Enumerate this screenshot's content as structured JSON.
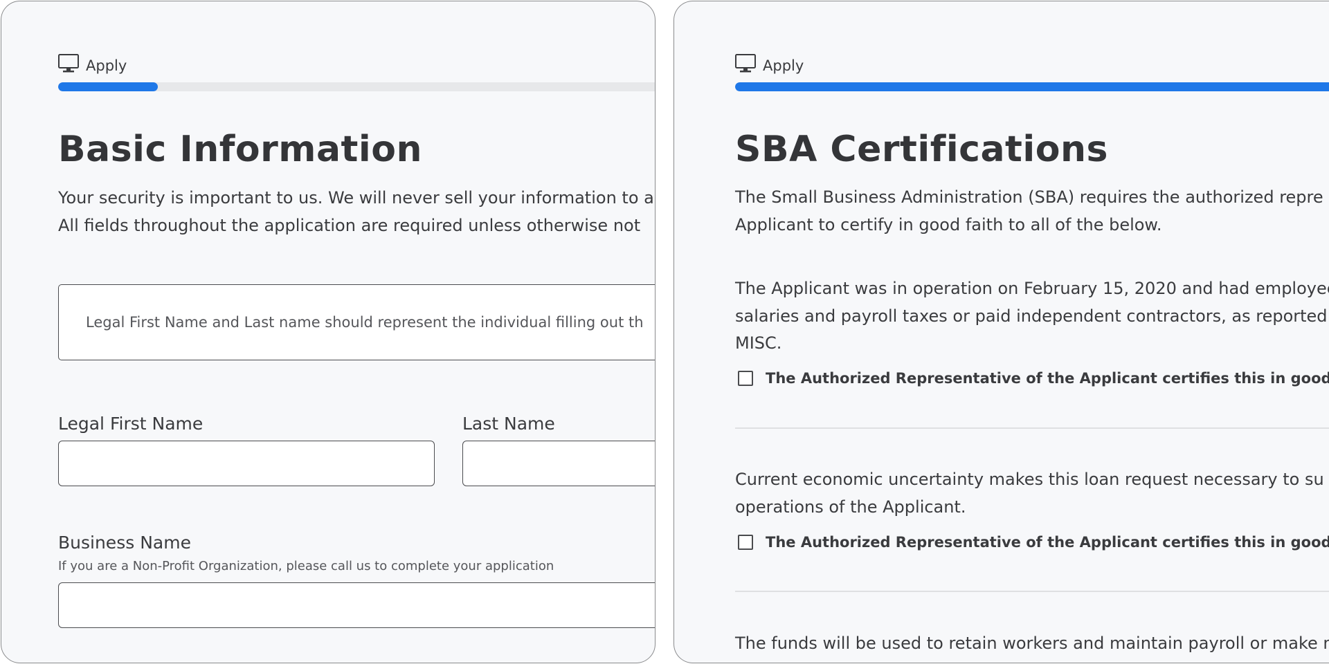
{
  "basic_info": {
    "header": {
      "label": "Apply",
      "icon": "monitor-icon",
      "progress": 0.12
    },
    "title": "Basic Information",
    "intro": [
      "Your security is important to us. We will never sell your information to a",
      "All fields throughout the application are required unless otherwise not"
    ],
    "note": "Legal First Name and Last name should represent the individual filling out th",
    "fields": {
      "first_name": {
        "label": "Legal First Name",
        "value": ""
      },
      "last_name": {
        "label": "Last Name",
        "value": ""
      },
      "business_name": {
        "label": "Business Name",
        "hint": "If you are a Non-Profit Organization, please call us to complete your application",
        "value": ""
      }
    }
  },
  "sba": {
    "header": {
      "label": "Apply",
      "icon": "monitor-icon",
      "progress": 0.85
    },
    "title": "SBA Certifications",
    "intro": [
      "The Small Business Administration (SBA) requires the authorized repre",
      "Applicant to certify in good faith to all of the below."
    ],
    "certifications": [
      {
        "text": [
          "The Applicant was in operation on February 15, 2020 and had employee",
          "salaries and payroll taxes or paid independent contractors, as reported",
          "MISC."
        ],
        "checkbox_label": "The Authorized Representative of the Applicant certifies this in good faith.",
        "checked": false
      },
      {
        "text": [
          "Current economic uncertainty makes this loan request necessary to su",
          "operations of the Applicant."
        ],
        "checkbox_label": "The Authorized Representative of the Applicant certifies this in good faith.",
        "checked": false
      },
      {
        "text": [
          "The funds will be used to retain workers and maintain payroll or make m"
        ]
      }
    ]
  },
  "colors": {
    "accent": "#1f78e8",
    "panel_bg": "#f7f8fa",
    "track": "#e7e8ea",
    "text": "#3a3b3e"
  }
}
